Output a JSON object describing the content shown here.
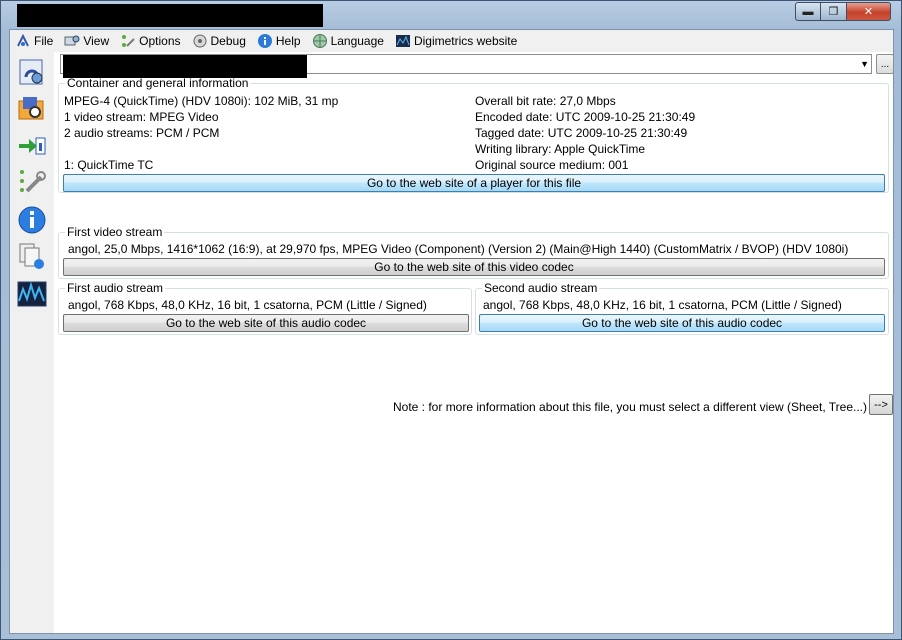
{
  "menu": {
    "items": [
      {
        "label": "File",
        "icon": "file-properties-icon"
      },
      {
        "label": "View",
        "icon": "view-icon"
      },
      {
        "label": "Options",
        "icon": "options-icon"
      },
      {
        "label": "Debug",
        "icon": "debug-icon"
      },
      {
        "label": "Help",
        "icon": "help-icon"
      },
      {
        "label": "Language",
        "icon": "language-globe-icon"
      },
      {
        "label": "Digimetrics website",
        "icon": "digimetrics-icon"
      }
    ]
  },
  "toolbar": {
    "more_label": "...",
    "icons": [
      "open-file-icon",
      "open-folder-icon",
      "export-icon",
      "preferences-icon",
      "about-icon",
      "knowledge-base-icon",
      "spectrum-icon"
    ]
  },
  "general": {
    "legend": "Container and general information",
    "left_lines": [
      "MPEG-4 (QuickTime) (HDV 1080i): 102 MiB, 31 mp",
      "1 video stream: MPEG Video",
      "2 audio streams: PCM / PCM",
      "",
      "1: QuickTime TC"
    ],
    "right_lines": [
      "Overall bit rate: 27,0 Mbps",
      "Encoded date: UTC 2009-10-25 21:30:49",
      "Tagged date: UTC 2009-10-25 21:30:49",
      "Writing library: Apple QuickTime",
      "Original source medium: 001"
    ],
    "button": "Go to the web site of a player for this file"
  },
  "video": {
    "legend": "First video stream",
    "line": "angol, 25,0 Mbps, 1416*1062 (16:9), at 29,970 fps, MPEG Video (Component) (Version 2) (Main@High 1440) (CustomMatrix / BVOP) (HDV 1080i)",
    "button": "Go to the web site of this video codec"
  },
  "audio1": {
    "legend": "First audio stream",
    "line": "angol, 768 Kbps, 48,0 KHz, 16 bit, 1 csatorna, PCM (Little / Signed)",
    "button": "Go to the web site of this audio codec"
  },
  "audio2": {
    "legend": "Second audio stream",
    "line": "angol, 768 Kbps, 48,0 KHz, 16 bit, 1 csatorna, PCM (Little / Signed)",
    "button": "Go to the web site of this audio codec"
  },
  "note": {
    "text": "Note : for more information about this file, you must select a different view (Sheet, Tree...)",
    "button": "-->"
  },
  "window": {
    "min": "▬",
    "max": "❐",
    "close": "✕"
  }
}
